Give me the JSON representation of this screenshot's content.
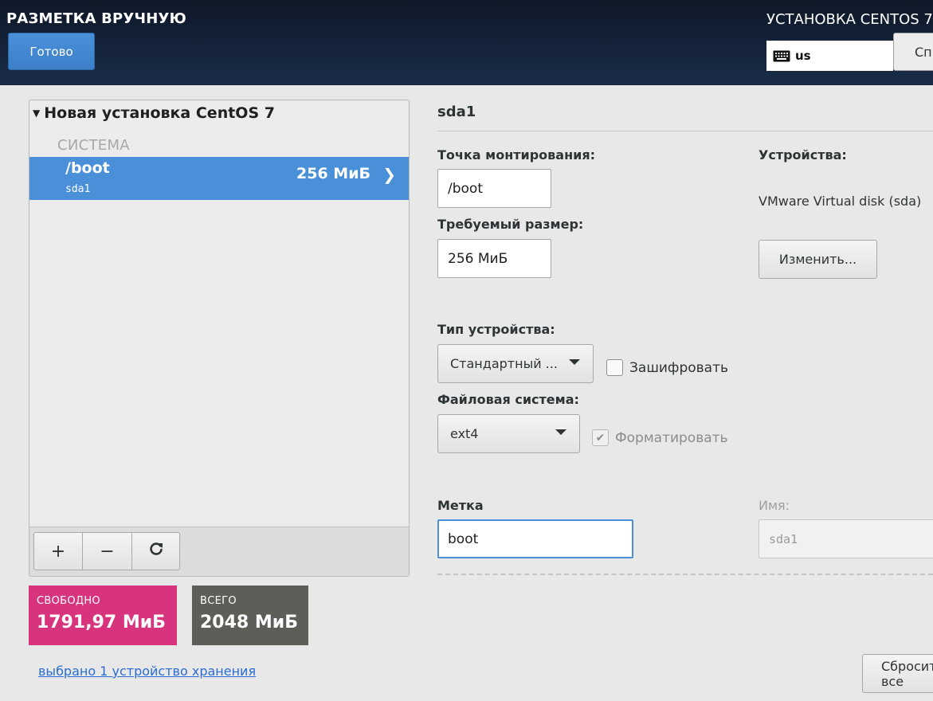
{
  "header": {
    "title": "РАЗМЕТКА ВРУЧНУЮ",
    "done_label": "Готово",
    "install_title": "УСТАНОВКА CENTOS 7",
    "keyboard_layout": "us",
    "help_label": "Справка!"
  },
  "tree": {
    "root_label": "Новая установка CentOS 7",
    "system_label": "СИСТЕМА",
    "partitions": [
      {
        "mount": "/boot",
        "device": "sda1",
        "size": "256 МиБ",
        "selected": true
      }
    ]
  },
  "toolbar": {
    "add": "+",
    "remove": "−",
    "refresh": "⟳"
  },
  "space": {
    "free_label": "СВОБОДНО",
    "free_value": "1791,97 МиБ",
    "total_label": "ВСЕГО",
    "total_value": "2048 МиБ"
  },
  "storage_link": "выбрано 1 устройство хранения",
  "detail": {
    "title": "sda1",
    "mount_point_label": "Точка монтирования:",
    "mount_point_value": "/boot",
    "size_label": "Требуемый размер:",
    "size_value": "256 МиБ",
    "devices_label": "Устройства:",
    "devices_value": "VMware Virtual disk (sda)",
    "modify_label": "Изменить...",
    "device_type_label": "Тип устройства:",
    "device_type_value": "Стандартный ...",
    "encrypt_label": "Зашифровать",
    "encrypt_checked": false,
    "filesystem_label": "Файловая система:",
    "filesystem_value": "ext4",
    "format_label": "Форматировать",
    "format_checked": true,
    "label_label": "Метка",
    "label_value": "boot",
    "name_label": "Имя:",
    "name_value": "sda1",
    "reset_label": "Сбросить все"
  },
  "colors": {
    "accent": "#4a90d9",
    "free_bg": "#d8347d",
    "total_bg": "#5e5d58",
    "header_bg": "#14233a"
  }
}
